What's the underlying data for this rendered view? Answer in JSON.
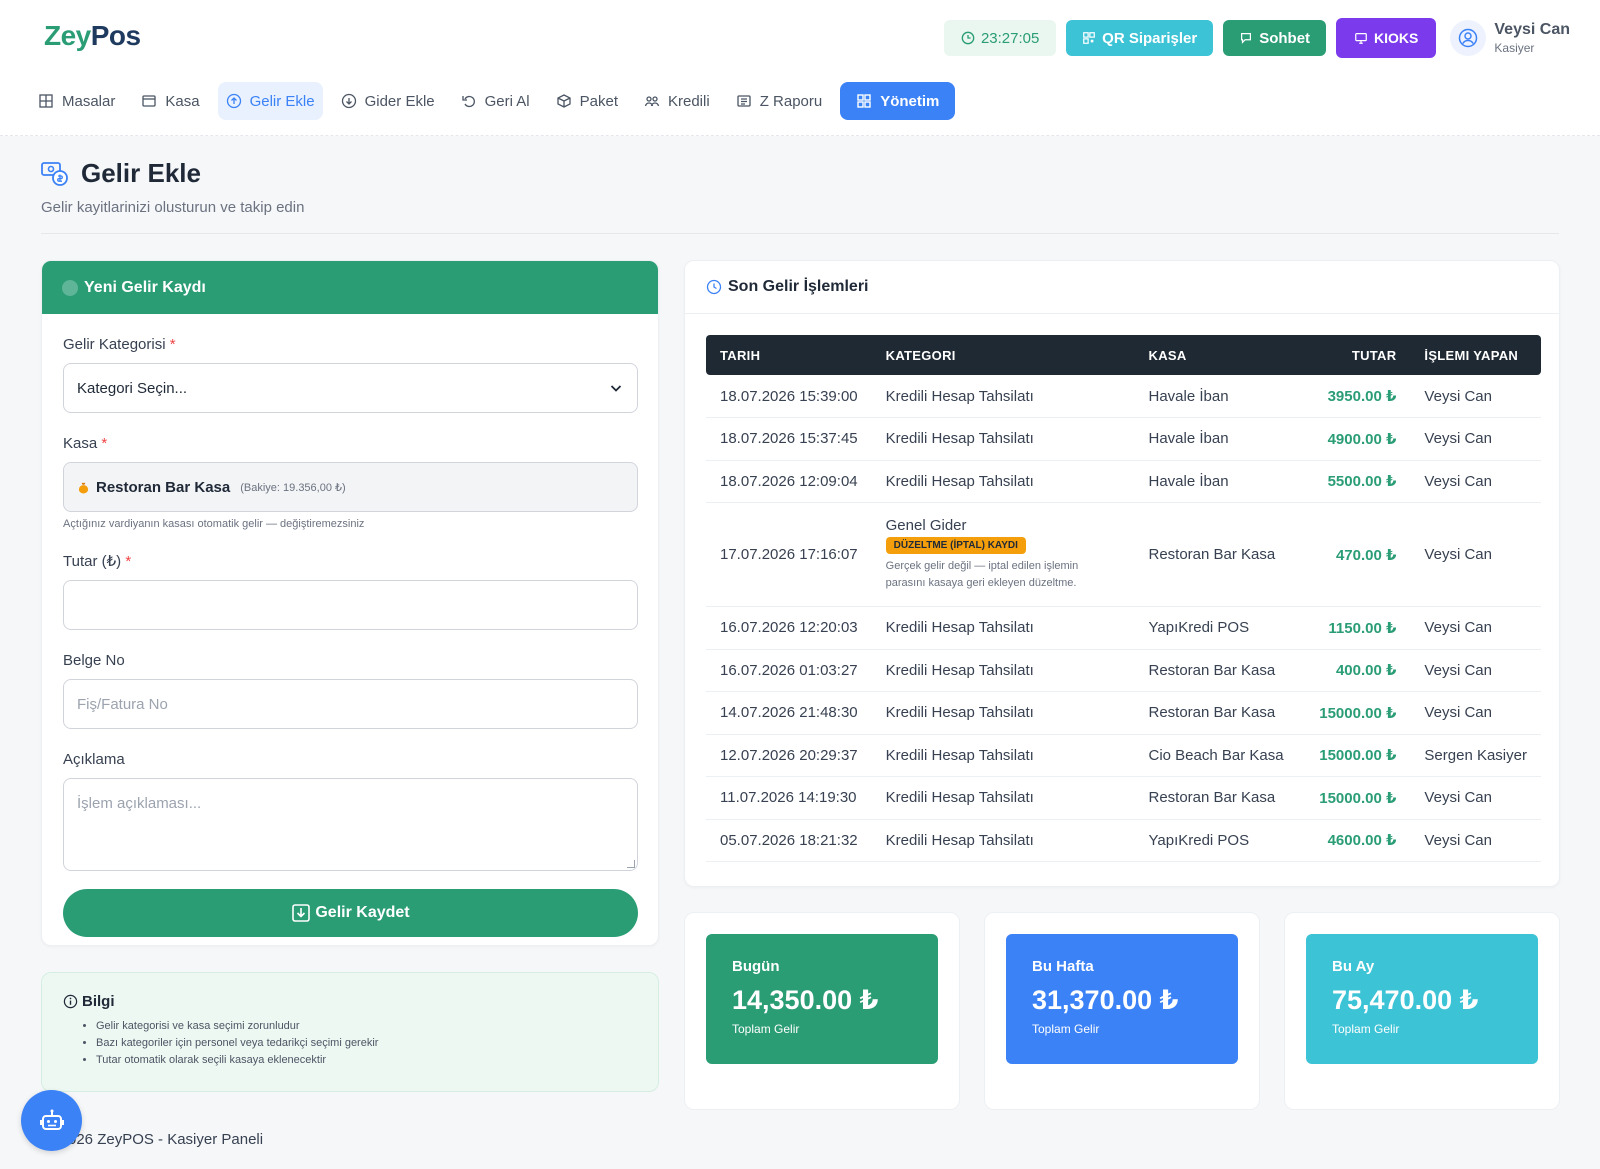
{
  "app": {
    "logo_prefix": "Zey",
    "logo_suffix": "Pos"
  },
  "header": {
    "clock": "23:27:05",
    "qr_label": "QR Siparişler",
    "chat_label": "Sohbet",
    "kiosk_label": "KIOKS",
    "user_name": "Veysi Can",
    "user_role": "Kasiyer"
  },
  "nav": {
    "items": [
      {
        "label": "Masalar",
        "icon": "grid-icon"
      },
      {
        "label": "Kasa",
        "icon": "register-icon"
      },
      {
        "label": "Gelir Ekle",
        "icon": "arrow-up-circle-icon"
      },
      {
        "label": "Gider Ekle",
        "icon": "arrow-down-circle-icon"
      },
      {
        "label": "Geri Al",
        "icon": "undo-icon"
      },
      {
        "label": "Paket",
        "icon": "package-icon"
      },
      {
        "label": "Kredili",
        "icon": "users-icon"
      },
      {
        "label": "Z Raporu",
        "icon": "report-icon"
      },
      {
        "label": "Yönetim",
        "icon": "dashboard-icon"
      }
    ]
  },
  "page": {
    "title": "Gelir Ekle",
    "subtitle": "Gelir kayitlarinizi olusturun ve takip edin"
  },
  "form": {
    "header": "Yeni Gelir Kaydı",
    "category_label": "Gelir Kategorisi",
    "required_mark": "*",
    "category_value": "Kategori Seçin...",
    "kasa_label": "Kasa",
    "kasa_name": "Restoran Bar Kasa",
    "kasa_balance": "(Bakiye: 19.356,00 ₺)",
    "kasa_hint": "Açtığınız vardiyanın kasası otomatik gelir — değiştiremezsiniz",
    "amount_label": "Tutar (₺)",
    "amount_value": "",
    "doc_label": "Belge No",
    "doc_placeholder": "Fiş/Fatura No",
    "desc_label": "Açıklama",
    "desc_placeholder": "İşlem açıklaması...",
    "submit_label": "Gelir Kaydet"
  },
  "info": {
    "title": "Bilgi",
    "items": [
      "Gelir kategorisi ve kasa seçimi zorunludur",
      "Bazı kategoriler için personel veya tedarikçi seçimi gerekir",
      "Tutar otomatik olarak seçili kasaya eklenecektir"
    ]
  },
  "transactions": {
    "title": "Son Gelir İşlemleri",
    "columns": [
      "TARIH",
      "KATEGORI",
      "KASA",
      "TUTAR",
      "İŞLEMI YAPAN"
    ],
    "rows": [
      {
        "date": "18.07.2026 15:39:00",
        "category": "Kredili Hesap Tahsilatı",
        "kasa": "Havale İban",
        "amount": "3950.00 ₺",
        "user": "Veysi Can"
      },
      {
        "date": "18.07.2026 15:37:45",
        "category": "Kredili Hesap Tahsilatı",
        "kasa": "Havale İban",
        "amount": "4900.00 ₺",
        "user": "Veysi Can"
      },
      {
        "date": "18.07.2026 12:09:04",
        "category": "Kredili Hesap Tahsilatı",
        "kasa": "Havale İban",
        "amount": "5500.00 ₺",
        "user": "Veysi Can"
      },
      {
        "date": "17.07.2026 17:16:07",
        "category": "Genel Gider",
        "badge": "DÜZELTME (İPTAL) KAYDI",
        "note": "Gerçek gelir değil — iptal edilen işlemin parasını kasaya geri ekleyen düzeltme.",
        "kasa": "Restoran Bar Kasa",
        "amount": "470.00 ₺",
        "user": "Veysi Can"
      },
      {
        "date": "16.07.2026 12:20:03",
        "category": "Kredili Hesap Tahsilatı",
        "kasa": "YapıKredi POS",
        "amount": "1150.00 ₺",
        "user": "Veysi Can"
      },
      {
        "date": "16.07.2026 01:03:27",
        "category": "Kredili Hesap Tahsilatı",
        "kasa": "Restoran Bar Kasa",
        "amount": "400.00 ₺",
        "user": "Veysi Can"
      },
      {
        "date": "14.07.2026 21:48:30",
        "category": "Kredili Hesap Tahsilatı",
        "kasa": "Restoran Bar Kasa",
        "amount": "15000.00 ₺",
        "user": "Veysi Can"
      },
      {
        "date": "12.07.2026 20:29:37",
        "category": "Kredili Hesap Tahsilatı",
        "kasa": "Cio Beach Bar Kasa",
        "amount": "15000.00 ₺",
        "user": "Sergen Kasiyer"
      },
      {
        "date": "11.07.2026 14:19:30",
        "category": "Kredili Hesap Tahsilatı",
        "kasa": "Restoran Bar Kasa",
        "amount": "15000.00 ₺",
        "user": "Veysi Can"
      },
      {
        "date": "05.07.2026 18:21:32",
        "category": "Kredili Hesap Tahsilatı",
        "kasa": "YapıKredi POS",
        "amount": "4600.00 ₺",
        "user": "Veysi Can"
      }
    ]
  },
  "stats": [
    {
      "label": "Bugün",
      "value": "14,350.00 ₺",
      "sub": "Toplam Gelir",
      "color": "#2a9d75"
    },
    {
      "label": "Bu Hafta",
      "value": "31,370.00 ₺",
      "sub": "Toplam Gelir",
      "color": "#3b82f6"
    },
    {
      "label": "Bu Ay",
      "value": "75,470.00 ₺",
      "sub": "Toplam Gelir",
      "color": "#3cc3d6"
    }
  ],
  "footer": {
    "text": "026 ZeyPOS - Kasiyer Paneli"
  },
  "colors": {
    "brand_green": "#2a9d75",
    "brand_blue": "#3b82f6",
    "kiosk_purple": "#7c3aed",
    "qr_cyan": "#3cc3d6",
    "table_header": "#1f2933",
    "badge_orange": "#f59e0b"
  }
}
